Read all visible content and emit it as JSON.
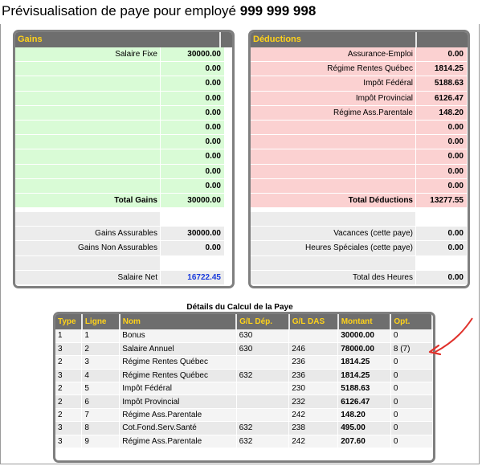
{
  "page": {
    "title_prefix": "Prévisualisation de paye pour employé",
    "employee_id": "999 999 998"
  },
  "gains": {
    "header": "Gains",
    "rows": [
      {
        "label": "Salaire Fixe",
        "value": "30000.00"
      },
      {
        "label": "",
        "value": "0.00"
      },
      {
        "label": "",
        "value": "0.00"
      },
      {
        "label": "",
        "value": "0.00"
      },
      {
        "label": "",
        "value": "0.00"
      },
      {
        "label": "",
        "value": "0.00"
      },
      {
        "label": "",
        "value": "0.00"
      },
      {
        "label": "",
        "value": "0.00"
      },
      {
        "label": "",
        "value": "0.00"
      },
      {
        "label": "",
        "value": "0.00"
      }
    ],
    "total_label": "Total Gains",
    "total_value": "30000.00",
    "insurable_label": "Gains Assurables",
    "insurable_value": "30000.00",
    "non_insurable_label": "Gains Non Assurables",
    "non_insurable_value": "0.00",
    "net_label": "Salaire Net",
    "net_value": "16722.45"
  },
  "deductions": {
    "header": "Déductions",
    "rows": [
      {
        "label": "Assurance-Emploi",
        "value": "0.00"
      },
      {
        "label": "Régime Rentes Québec",
        "value": "1814.25"
      },
      {
        "label": "Impôt Fédéral",
        "value": "5188.63"
      },
      {
        "label": "Impôt Provincial",
        "value": "6126.47"
      },
      {
        "label": "Régime Ass.Parentale",
        "value": "148.20"
      },
      {
        "label": "",
        "value": "0.00"
      },
      {
        "label": "",
        "value": "0.00"
      },
      {
        "label": "",
        "value": "0.00"
      },
      {
        "label": "",
        "value": "0.00"
      },
      {
        "label": "",
        "value": "0.00"
      }
    ],
    "total_label": "Total Déductions",
    "total_value": "13277.55",
    "vacation_label": "Vacances (cette paye)",
    "vacation_value": "0.00",
    "special_hours_label": "Heures Spéciales (cette paye)",
    "special_hours_value": "0.00",
    "hours_total_label": "Total des Heures",
    "hours_total_value": "0.00"
  },
  "details": {
    "title": "Détails du Calcul de la Paye",
    "columns": [
      "Type",
      "Ligne",
      "Nom",
      "G/L Dép.",
      "G/L DAS",
      "Montant",
      "Opt."
    ],
    "rows": [
      [
        "1",
        "1",
        "Bonus",
        "630",
        "",
        "30000.00",
        "0"
      ],
      [
        "3",
        "2",
        "Salaire Annuel",
        "630",
        "246",
        "78000.00",
        "8 (7)"
      ],
      [
        "2",
        "3",
        "Régime Rentes Québec",
        "",
        "236",
        "1814.25",
        "0"
      ],
      [
        "3",
        "4",
        "Régime Rentes Québec",
        "632",
        "236",
        "1814.25",
        "0"
      ],
      [
        "2",
        "5",
        "Impôt Fédéral",
        "",
        "230",
        "5188.63",
        "0"
      ],
      [
        "2",
        "6",
        "Impôt Provincial",
        "",
        "232",
        "6126.47",
        "0"
      ],
      [
        "2",
        "7",
        "Régime Ass.Parentale",
        "",
        "242",
        "148.20",
        "0"
      ],
      [
        "3",
        "8",
        "Cot.Fond.Serv.Santé",
        "632",
        "238",
        "495.00",
        "0"
      ],
      [
        "3",
        "9",
        "Régime Ass.Parentale",
        "632",
        "242",
        "207.60",
        "0"
      ]
    ]
  },
  "annotation": {
    "arrow_color": "#e0312b"
  }
}
